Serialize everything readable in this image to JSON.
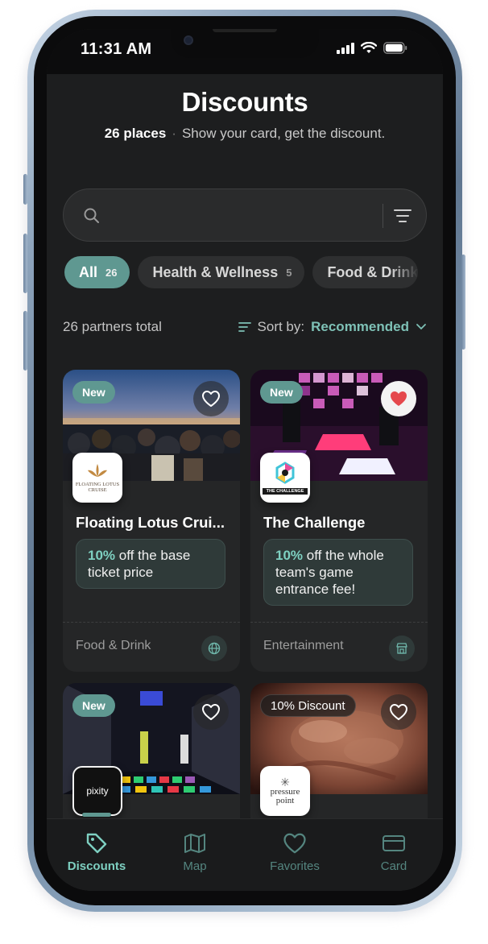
{
  "status_bar": {
    "time": "11:31 AM"
  },
  "header": {
    "title": "Discounts",
    "places_count": "26 places",
    "tagline": "Show your card, get the discount."
  },
  "search": {
    "placeholder": ""
  },
  "filters": [
    {
      "label": "All",
      "count": "26",
      "active": true
    },
    {
      "label": "Health & Wellness",
      "count": "5",
      "active": false
    },
    {
      "label": "Food & Drink",
      "count": "",
      "active": false
    }
  ],
  "list_meta": {
    "total": "26 partners total",
    "sort_label": "Sort by:",
    "sort_value": "Recommended"
  },
  "partners": [
    {
      "badge": "New",
      "favorite": false,
      "logo_text": "FLOATING LOTUS CRUISE",
      "name": "Floating Lotus Crui...",
      "offer_highlight": "10%",
      "offer_text": " off the base ticket price",
      "category": "Food & Drink",
      "category_icon": "globe-icon"
    },
    {
      "badge": "New",
      "favorite": true,
      "logo_text": "THE CHALLENGE",
      "name": "The Challenge",
      "offer_highlight": "10%",
      "offer_text": " off the whole team's game entrance fee!",
      "category": "Entertainment",
      "category_icon": "store-icon"
    },
    {
      "badge": "New",
      "favorite": false,
      "logo_text": "pixity",
      "name": "",
      "offer_highlight": "",
      "offer_text": "",
      "category": "",
      "category_icon": ""
    },
    {
      "badge": "10% Discount",
      "favorite": false,
      "logo_text": "pressure point",
      "name": "",
      "offer_highlight": "",
      "offer_text": "",
      "category": "",
      "category_icon": ""
    }
  ],
  "tab_bar": [
    {
      "label": "Discounts",
      "icon": "tag-icon",
      "active": true
    },
    {
      "label": "Map",
      "icon": "map-icon",
      "active": false
    },
    {
      "label": "Favorites",
      "icon": "heart-icon",
      "active": false
    },
    {
      "label": "Card",
      "icon": "card-icon",
      "active": false
    }
  ],
  "colors": {
    "accent": "#5f9891",
    "accent_text": "#7ec1b6",
    "background": "#1d1e1f",
    "card": "#252627",
    "heart_active": "#e5484d"
  }
}
